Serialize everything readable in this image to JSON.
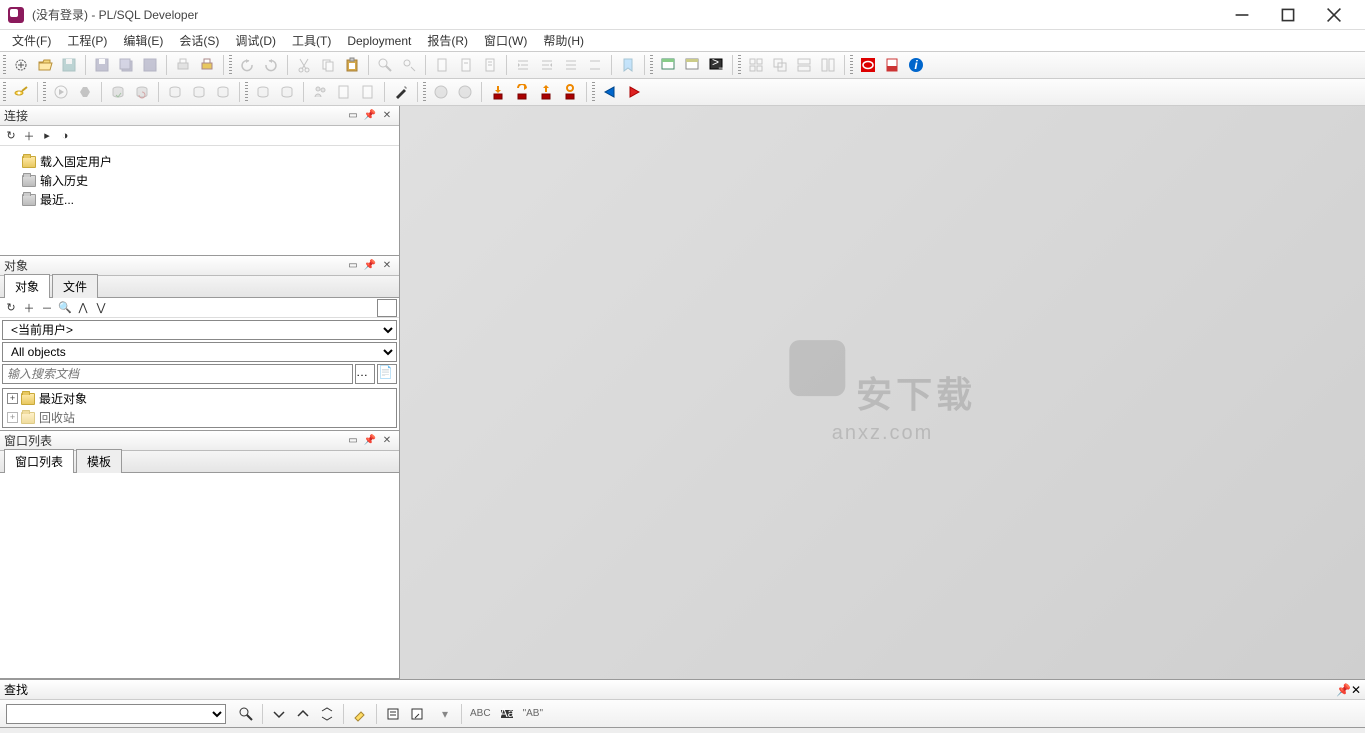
{
  "title": "(没有登录) - PL/SQL Developer",
  "menu": [
    "文件(F)",
    "工程(P)",
    "编辑(E)",
    "会话(S)",
    "调试(D)",
    "工具(T)",
    "Deployment",
    "报告(R)",
    "窗口(W)",
    "帮助(H)"
  ],
  "panels": {
    "connections": {
      "title": "连接",
      "items": [
        "载入固定用户",
        "输入历史",
        "最近..."
      ]
    },
    "objects": {
      "title": "对象",
      "tabs": [
        "对象",
        "文件"
      ],
      "user_combo": "<当前用户>",
      "filter_combo": "All objects",
      "search_placeholder": "输入搜索文档",
      "tree_items": [
        "最近对象",
        "回收站"
      ]
    },
    "windows": {
      "title": "窗口列表",
      "tabs": [
        "窗口列表",
        "模板"
      ]
    },
    "find": {
      "title": "查找"
    }
  },
  "find_tools": {
    "abc_label": "ABC",
    "ab_label": "\"AB\""
  },
  "watermark": {
    "text1": "安下载",
    "text2": "anxz.com"
  }
}
